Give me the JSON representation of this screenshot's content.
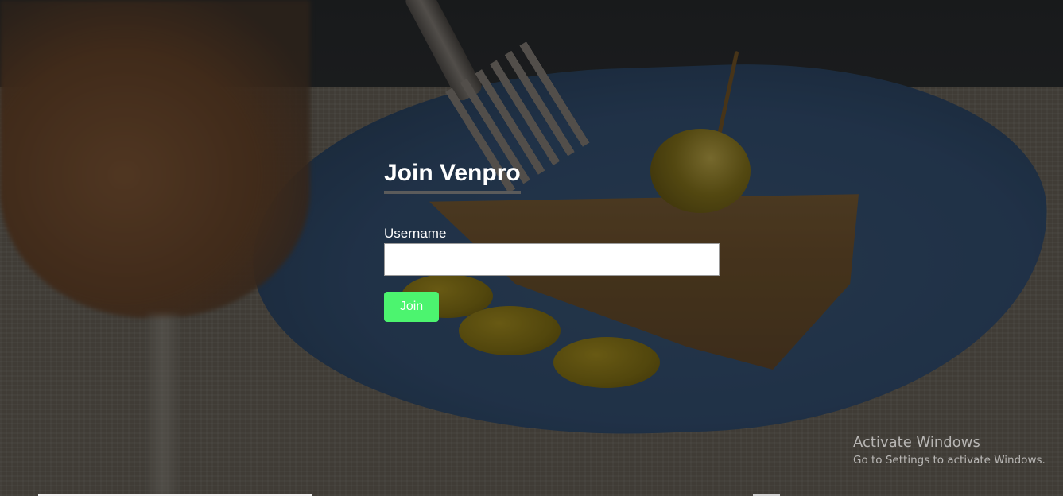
{
  "form": {
    "title": "Join Venpro",
    "username_label": "Username",
    "username_value": "",
    "join_label": "Join"
  },
  "watermark": {
    "title": "Activate Windows",
    "subtitle": "Go to Settings to activate Windows."
  },
  "colors": {
    "join_button": "#4cf46f",
    "title_underline": "#5b5b5b",
    "text": "#ffffff"
  }
}
